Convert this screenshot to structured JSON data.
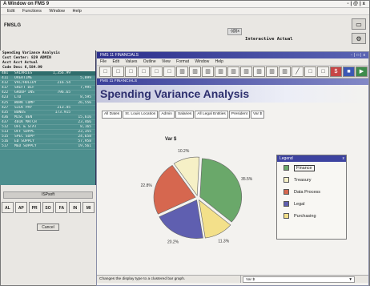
{
  "back_window": {
    "title": "A Window on FMS 9",
    "window_controls": "-|@|x",
    "menu": [
      "Edit",
      "Functions",
      "Window",
      "Help"
    ],
    "app_label": "FMSLG",
    "inner_controls": "-|@|x",
    "interactive_label": "Interactive Actual",
    "right_icons": [
      "▭",
      "⚙"
    ]
  },
  "terminal": {
    "heading_lines": [
      "Spending Variance Analysis",
      "Cost Center:  829  ADMIN",
      "Acct  Acct       Actual",
      "Code  Desc       6,584.99"
    ],
    "rows": [
      [
        "401",
        "SALARIES",
        "1,356.99",
        ""
      ],
      [
        "411",
        "OVERTIME",
        "",
        "5,899"
      ],
      [
        "412",
        "VAC/HOLIDY",
        "216.54",
        ""
      ],
      [
        "417",
        "SHIFT DIF",
        "",
        "7,995"
      ],
      [
        "422",
        "GROUP INS",
        "796.65",
        ""
      ],
      [
        "423",
        "LTD",
        "",
        "8,595"
      ],
      [
        "425",
        "WORK COMP",
        "",
        "26,556"
      ],
      [
        "427",
        "SICK PAY",
        "213.45",
        ""
      ],
      [
        "435",
        "BONUS",
        "173.915",
        ""
      ],
      [
        "436",
        "MISC BEN",
        "",
        "15,616"
      ],
      [
        "437",
        "401K MATCH",
        "",
        "23,466"
      ],
      [
        "512",
        "OFC & STAT",
        "",
        "8,165"
      ],
      [
        "513",
        "OFF SUPPL",
        "",
        "23,355"
      ],
      [
        "515",
        "SPEC SUPP",
        "",
        "24,658"
      ],
      [
        "516",
        "ED SUPPLY",
        "",
        "57,958"
      ],
      [
        "517",
        "MED SUPPLY",
        "",
        "19,561"
      ]
    ]
  },
  "back_footer": {
    "title": "ISPsoft",
    "tabs": [
      "AL",
      "AP",
      "PR",
      "SO",
      "FA",
      "IN",
      "MI"
    ],
    "button": "Cancel"
  },
  "front_window": {
    "title": "FMS 11 FINANCIALS",
    "window_controls": "-|□|x",
    "menu": [
      "File",
      "Edit",
      "Values",
      "Outline",
      "View",
      "Format",
      "Window",
      "Help"
    ],
    "toolbar": [
      "□",
      "□",
      "□",
      "□",
      "□",
      "□",
      "▥",
      "▥",
      "▥",
      "▥",
      "▥",
      "▥",
      "▥",
      "▥",
      "▥",
      "╱",
      "□",
      "□",
      "$",
      "■",
      "▶"
    ],
    "subtitle": "FMS 11 FINANCIALS",
    "report_title": "Spending Variance Analysis",
    "filters": [
      "All Dates",
      "St. Louis Location",
      "Admin",
      "Salaries",
      "All Legal Entities",
      "President",
      "Var $"
    ],
    "status_message": "Changes the display type to a clustered bar graph.",
    "status_select": "Var $",
    "status_select_arrow": "▼"
  },
  "legend": {
    "title": "Legend",
    "close": "x",
    "items": [
      {
        "label": "Finance",
        "color": "#6aa86a"
      },
      {
        "label": "Treasury",
        "color": "#f6f0c6"
      },
      {
        "label": "Data Process",
        "color": "#d6674f"
      },
      {
        "label": "Legal",
        "color": "#5f5fb0"
      },
      {
        "label": "Purchasing",
        "color": "#f3e08a"
      }
    ]
  },
  "chart_data": {
    "type": "pie",
    "title": "Var $",
    "categories": [
      "Finance",
      "Purchasing",
      "Legal",
      "Data Process",
      "Treasury"
    ],
    "values": [
      35.5,
      11.3,
      20.2,
      22.8,
      10.2
    ],
    "labels": [
      "35.5%",
      "11.3%",
      "20.2%",
      "22.8%",
      "10.2%"
    ],
    "colors": [
      "#6aa86a",
      "#f3e08a",
      "#5f5fb0",
      "#d6674f",
      "#f6f0c6"
    ],
    "legend_position": "right"
  }
}
